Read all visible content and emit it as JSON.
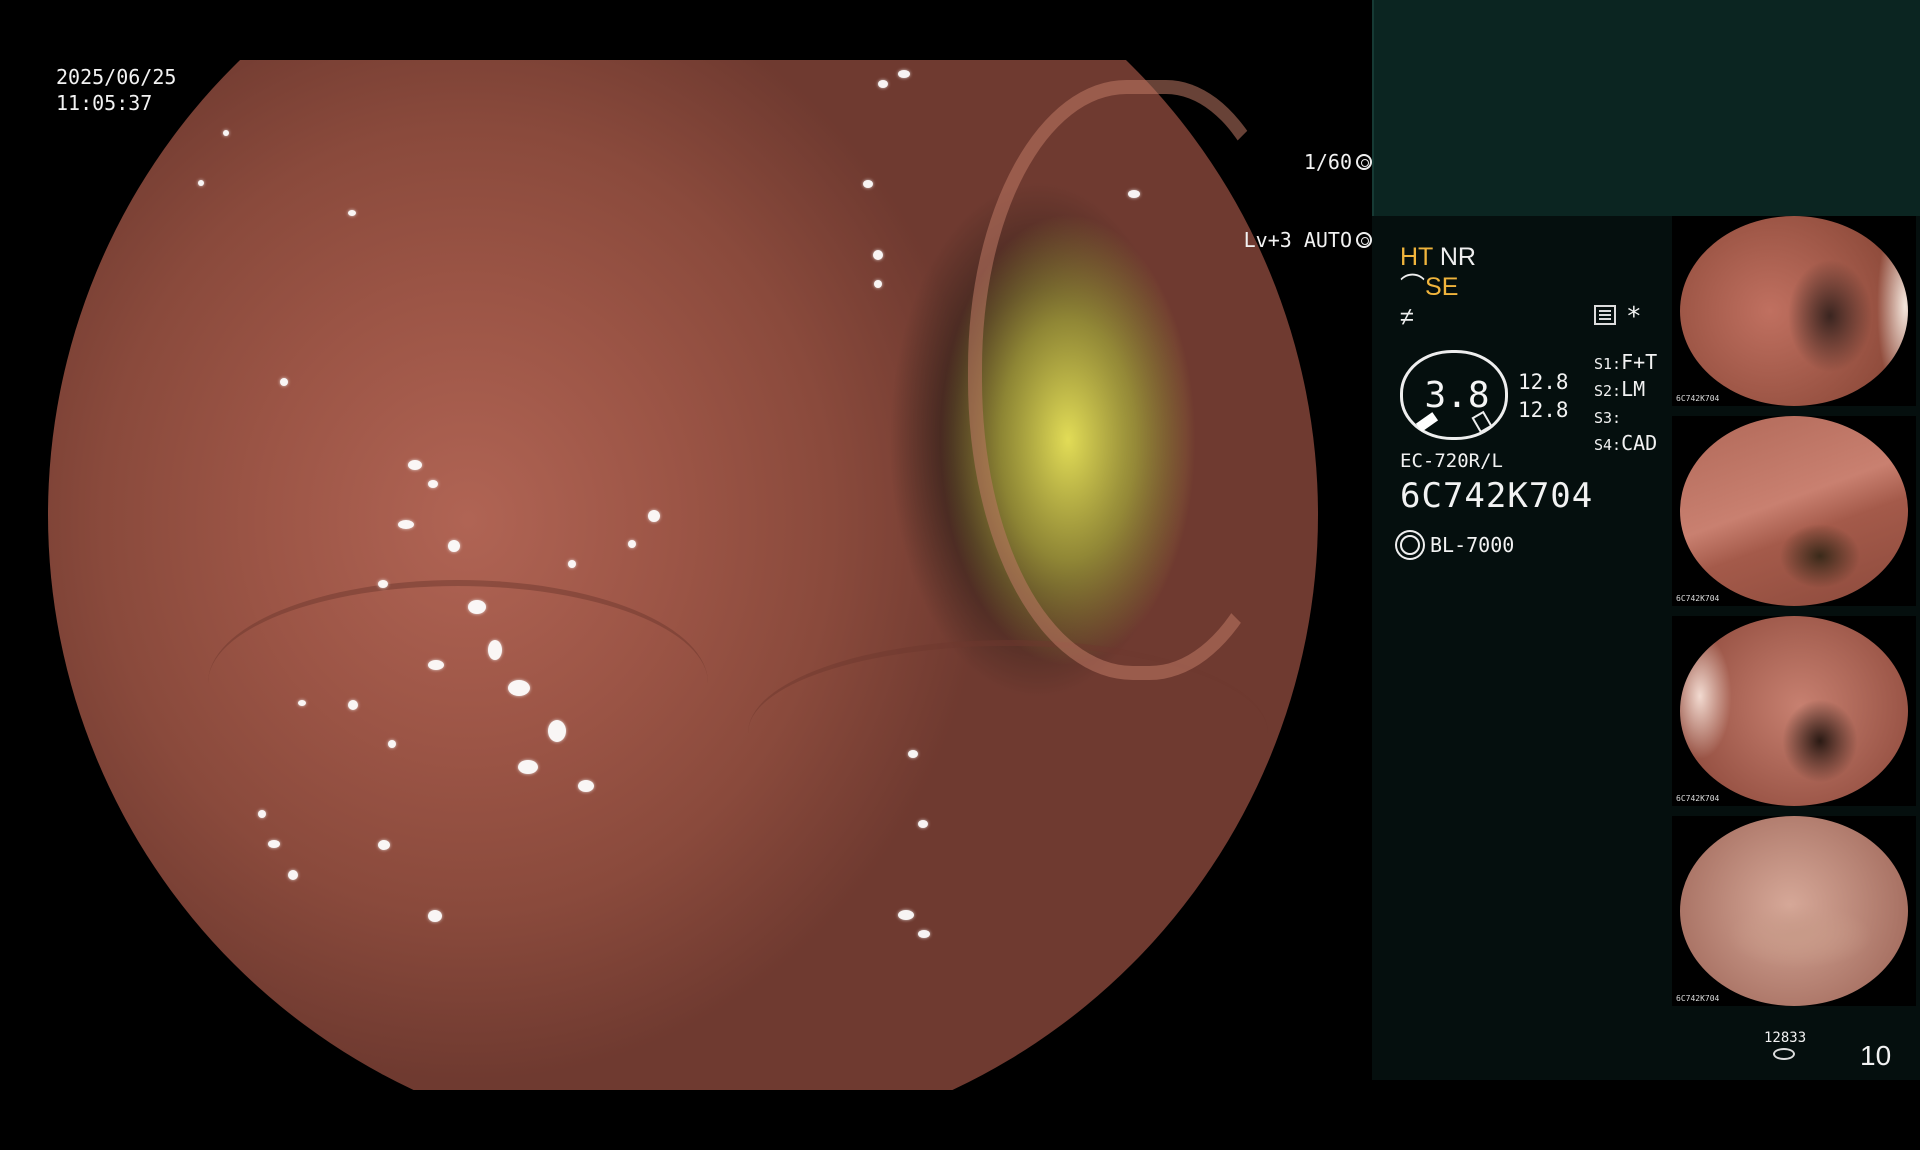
{
  "overlay": {
    "date": "2025/06/25",
    "time": "11:05:37",
    "shutter": "1/60",
    "iris_level": "Lv+3 AUTO"
  },
  "panel": {
    "mode_ht": "HT",
    "mode_nr": "NR",
    "mode_se": "SE",
    "gauge_value": "3.8",
    "num_top": "12.8",
    "num_bottom": "12.8",
    "s1_key": "S1:",
    "s1_val": "F+T",
    "s2_key": "S2:",
    "s2_val": "LM",
    "s3_key": "S3:",
    "s3_val": "",
    "s4_key": "S4:",
    "s4_val": "CAD",
    "asterisk": "*",
    "scope_model": "EC-720R/L",
    "scope_serial": "6C742K704",
    "light_source": "BL-7000",
    "storage_count": "12833",
    "page_number": "10",
    "thumb_caption": "6C742K704"
  },
  "colors": {
    "panel_bg": "#050f0e",
    "header_bg": "#0b2521",
    "highlight": "#f0b43c"
  }
}
